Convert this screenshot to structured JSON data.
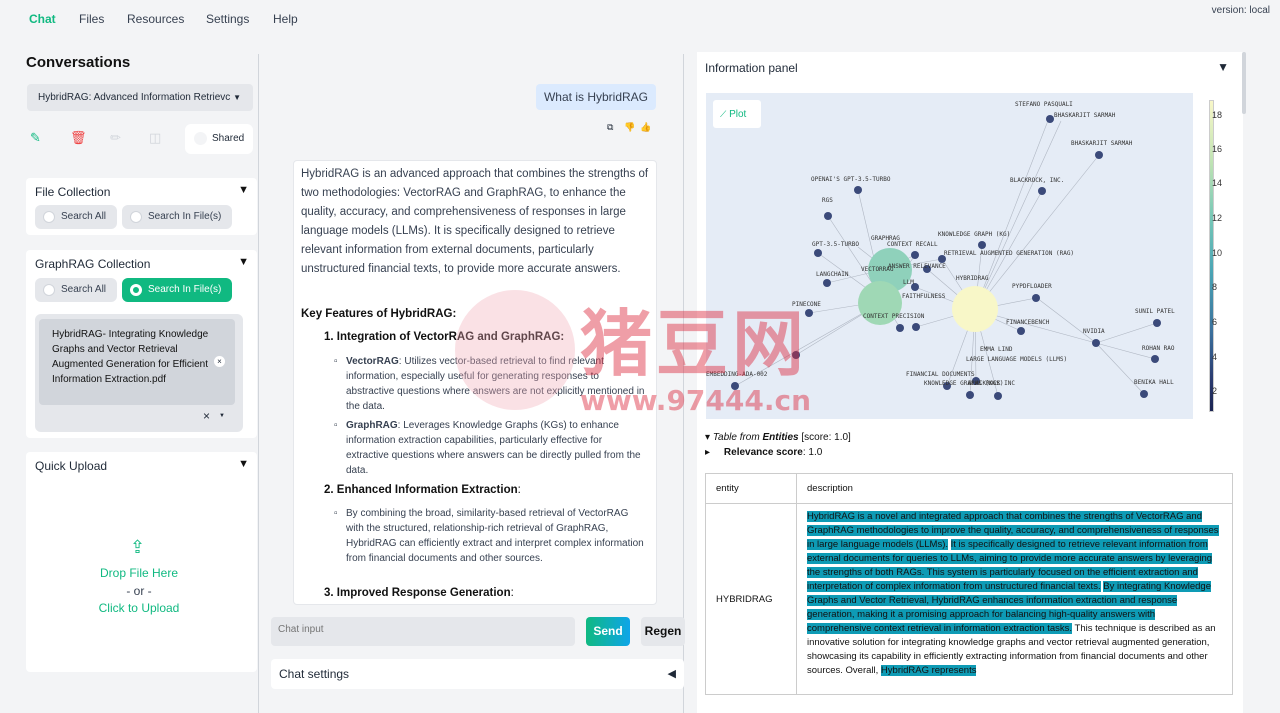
{
  "nav": {
    "chat": "Chat",
    "files": "Files",
    "resources": "Resources",
    "settings": "Settings",
    "help": "Help",
    "version": "version: local"
  },
  "sidebar": {
    "title": "Conversations",
    "conversation_select": "HybridRAG: Advanced Information Retrievc",
    "shared_label": "Shared",
    "file_collection": {
      "title": "File Collection",
      "search_all": "Search All",
      "search_in_files": "Search In File(s)"
    },
    "graphrag_collection": {
      "title": "GraphRAG Collection",
      "search_all": "Search All",
      "search_in_files": "Search In File(s)",
      "selected_file": "HybridRAG- Integrating Knowledge Graphs and Vector Retrieval Augmented Generation for Efficient Information Extraction.pdf"
    },
    "quick_upload": {
      "title": "Quick Upload",
      "drop": "Drop File Here",
      "or": "- or -",
      "click": "Click to Upload"
    }
  },
  "chat": {
    "user_message": "What is HybridRAG",
    "answer_intro": "HybridRAG is an advanced approach that combines the strengths of two methodologies: VectorRAG and GraphRAG, to enhance the quality, accuracy, and comprehensiveness of responses in large language models (LLMs). It is specifically designed to retrieve relevant information from external documents, particularly unstructured financial texts, to provide more accurate answers.",
    "key_features": "Key Features of HybridRAG:",
    "item1": "1. Integration of VectorRAG and GraphRAG:",
    "item1_b1_bold": "VectorRAG",
    "item1_b1": ": Utilizes vector-based retrieval to find relevant information, especially useful for generating responses to abstractive questions where answers are not explicitly mentioned in the data.",
    "item1_b2_bold": "GraphRAG",
    "item1_b2": ": Leverages Knowledge Graphs (KGs) to enhance information extraction capabilities, particularly effective for extractive questions where answers can be directly pulled from the data.",
    "item2": "2. Enhanced Information Extraction",
    "item2_b1": "By combining the broad, similarity-based retrieval of VectorRAG with the structured, relationship-rich retrieval of GraphRAG, HybridRAG can efficiently extract and interpret complex information from financial documents and other sources.",
    "item3": "3. Improved Response Generation",
    "input_placeholder": "Chat input",
    "send": "Send",
    "regen": "Regen",
    "settings": "Chat settings"
  },
  "info": {
    "title": "Information panel",
    "plot_button": "Plot",
    "table_title_pre": "Table from ",
    "table_title_bold": "Entities",
    "table_score": " [score: 1.0]",
    "relevance_label": "Relevance score",
    "relevance_value": ": 1.0",
    "col_entity": "entity",
    "col_description": "description",
    "row_entity": "HYBRIDRAG",
    "desc_hl1": "HybridRAG is a novel and integrated approach that combines the strengths of VectorRAG and GraphRAG methodologies to improve the quality, accuracy, and comprehensiveness of responses in large language models (LLMs).",
    "desc_hl2": "It is specifically designed to retrieve relevant information from external documents for queries to LLMs, aiming to provide more accurate answers by leveraging the strengths of both RAGs. This system is particularly focused on the efficient extraction and interpretation of complex information from unstructured financial texts.",
    "desc_hl3": "By integrating Knowledge Graphs and Vector Retrieval, HybridRAG enhances information extraction and response generation, making it a promising approach for balancing high-quality answers with comprehensive context retrieval in information extraction tasks.",
    "desc_plain": " This technique is described as an innovative solution for integrating knowledge graphs and vector retrieval augmented generation, showcasing its capability in efficiently extracting information from financial documents and other sources. Overall, ",
    "desc_hl4": "HybridRAG represents",
    "colorbar_ticks": [
      "18",
      "16",
      "14",
      "12",
      "10",
      "8",
      "6",
      "4",
      "2"
    ],
    "graph_labels": [
      "STEFANO PASQUALI",
      "BHASKARJIT SARMAH",
      "BHASKARJIT SARMAH",
      "BLACKROCK, INC.",
      "OPENAI'S GPT-3.5-TURBO",
      "RGS",
      "GRAPHRAG",
      "CONTEXT RECALL",
      "KNOWLEDGE GRAPH (KG)",
      "GPT-3.5-TURBO",
      "VECTORRAG",
      "ANSWER RELEVANCE",
      "RETRIEVAL AUGMENTED GENERATION (RAG)",
      "LANGCHAIN",
      "LLM",
      "HYBRIDRAG",
      "FAITHFULNESS",
      "PYPDFLOADER",
      "CONTEXT PRECISION",
      "FINANCEBENCH",
      "NVIDIA",
      "SUNIL PATEL",
      "EMMA LIND",
      "LARGE LANGUAGE MODELS (LLMS)",
      "ROHAN RAO",
      "FINANCIAL DOCUMENTS",
      "BENIKA HALL",
      "KNOWLEDGE GRAPHS (KGS)",
      "BLACKROCK INC",
      "EMBEDDING-ADA-002",
      "PINECONE"
    ]
  },
  "watermark": {
    "site": "猪豆网",
    "url": "www.97444.cn"
  }
}
